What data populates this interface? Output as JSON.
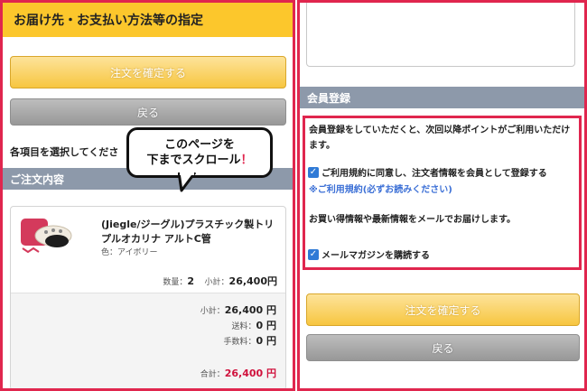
{
  "left": {
    "header_title": "お届け先・お支払い方法等の指定",
    "confirm_button": "注文を確定する",
    "back_button": "戻る",
    "instruction": "各項目を選択してくださ",
    "order_section_title": "ご注文内容",
    "product": {
      "name": "(Jiegle/ジーグル)プラスチック製トリプルオカリナ アルトC管",
      "color": "色：アイボリー",
      "quantity_label": "数量：",
      "quantity": "2",
      "subtotal_label": "小計：",
      "subtotal": "26,400円"
    },
    "totals": {
      "subtotal_label": "小計：",
      "subtotal": "26,400 円",
      "shipping_label": "送料：",
      "shipping": "0 円",
      "fee_label": "手数料：",
      "fee": "0 円",
      "total_label": "合計：",
      "total": "26,400 円"
    }
  },
  "callout": {
    "line1": "このページを",
    "line2": "下までスクロール",
    "mark": "！"
  },
  "right": {
    "member_section_title": "会員登録",
    "member_info": "会員登録をしていただくと、次回以降ポイントがご利用いただけます。",
    "register_checkbox_label": "ご利用規約に同意し、注文者情報を会員として登録する",
    "terms_link": "※ご利用規約(必ずお読みください)",
    "newsletter_info": "お買い得情報や最新情報をメールでお届けします。",
    "newsletter_checkbox_label": "メールマガジンを購読する",
    "confirm_button": "注文を確定する",
    "back_button": "戻る"
  },
  "colors": {
    "accent": "#fcc72c",
    "highlight_border": "#e0264e",
    "section_header": "#8d99aa",
    "link": "#3b6fd6",
    "total_red": "#d0113c"
  },
  "icons": [
    "check-icon",
    "product-thumbnail"
  ]
}
